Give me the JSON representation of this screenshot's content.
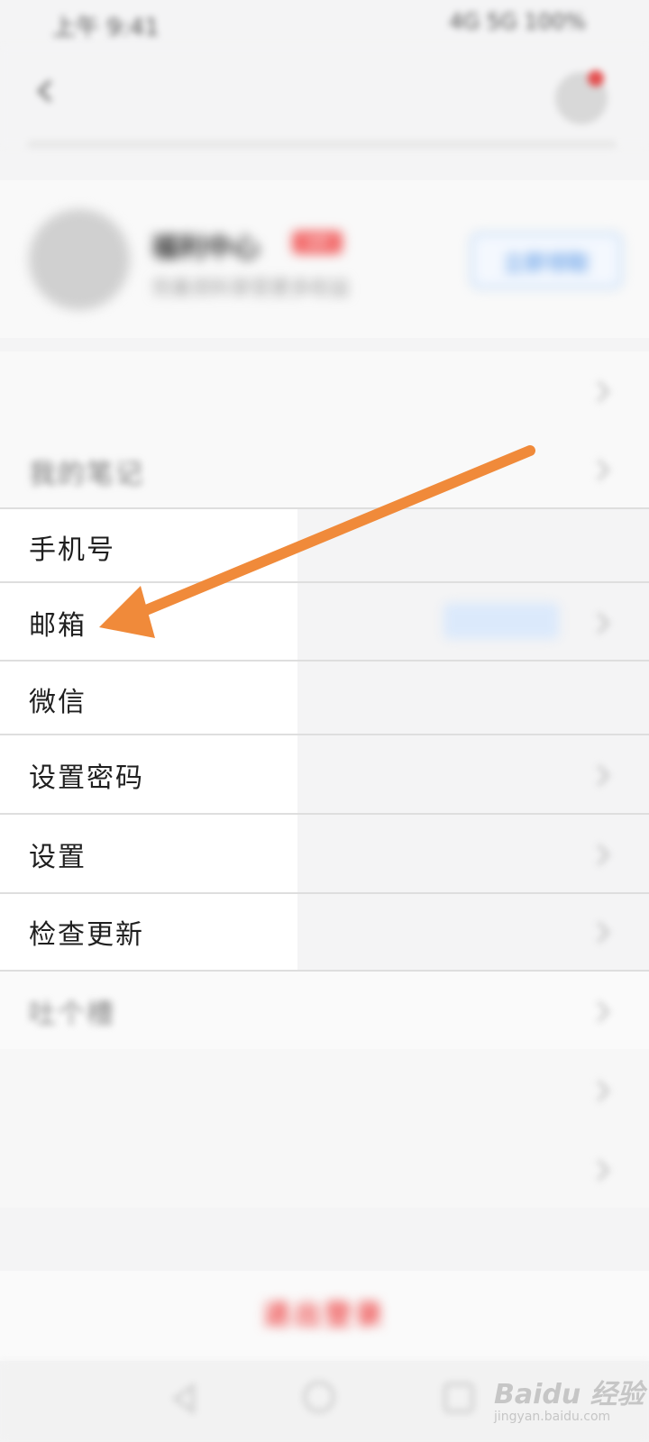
{
  "status_bar": {
    "left_text": "上午 9:41",
    "right_text": "4G 5G 100%"
  },
  "header": {
    "back_icon": "back-icon",
    "message_icon": "message-icon"
  },
  "profile": {
    "name": "福利中心",
    "badge": "VIP",
    "subtitle": "完善资料享受更多权益",
    "action_label": "立即领取"
  },
  "list": {
    "items": [
      {
        "label": "",
        "value": ""
      },
      {
        "label": "我的笔记",
        "value": ""
      },
      {
        "label": "手机号",
        "value": ""
      },
      {
        "label": "邮箱",
        "value": ""
      },
      {
        "label": "微信",
        "value": ""
      },
      {
        "label": "设置密码",
        "value": ""
      },
      {
        "label": "设置",
        "value": ""
      },
      {
        "label": "检查更新",
        "value": ""
      },
      {
        "label": "吐个槽",
        "value": ""
      },
      {
        "label": "",
        "value": ""
      },
      {
        "label": "",
        "value": ""
      }
    ]
  },
  "logout": {
    "label": "退出登录"
  },
  "watermark": {
    "text": "Baidu 经验",
    "sub": "jingyan.baidu.com"
  },
  "annotation": {
    "arrow_color": "#f08a3a"
  }
}
